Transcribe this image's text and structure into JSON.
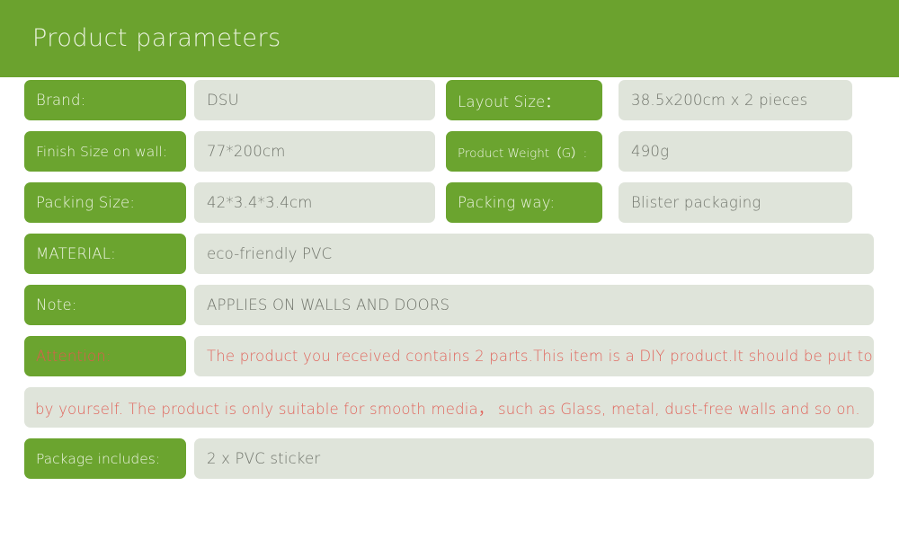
{
  "header": {
    "title": "Product parameters",
    "background_color": "#6ba22e",
    "title_color": "#e9f2dd"
  },
  "theme": {
    "label_pill_color": "#6ba42f",
    "label_text_color": "#eef5e4",
    "value_box_color": "#dfe4da",
    "value_text_color": "#70746b",
    "alert_text_color": "#e0655c"
  },
  "parameters": {
    "paired_rows": [
      {
        "left": {
          "label": "Brand:",
          "value": "DSU"
        },
        "right": {
          "label": "Layout Size：",
          "value": "38.5x200cm x 2 pieces"
        }
      },
      {
        "left": {
          "label": "Finish Size on wall:",
          "value": "77*200cm"
        },
        "right": {
          "label": "Product Weight（G）:",
          "value": "490g"
        }
      },
      {
        "left": {
          "label": "Packing Size:",
          "value": "42*3.4*3.4cm"
        },
        "right": {
          "label": "Packing way:",
          "value": "Blister packaging"
        }
      }
    ],
    "full_rows": [
      {
        "label": "MATERIAL:",
        "value": "eco-friendly PVC"
      },
      {
        "label": "Note:",
        "value": "APPLIES ON WALLS AND DOORS"
      }
    ],
    "attention": {
      "label": "Attention:",
      "value_line_1": "The product you received contains 2 parts.This item is a DIY product.It should be put together",
      "value_line_2": "by yourself. The product is only suitable for smooth media，  such as Glass, metal, dust-free walls and so on."
    },
    "package": {
      "label": "Package includes:",
      "value": "2 x PVC sticker"
    }
  }
}
